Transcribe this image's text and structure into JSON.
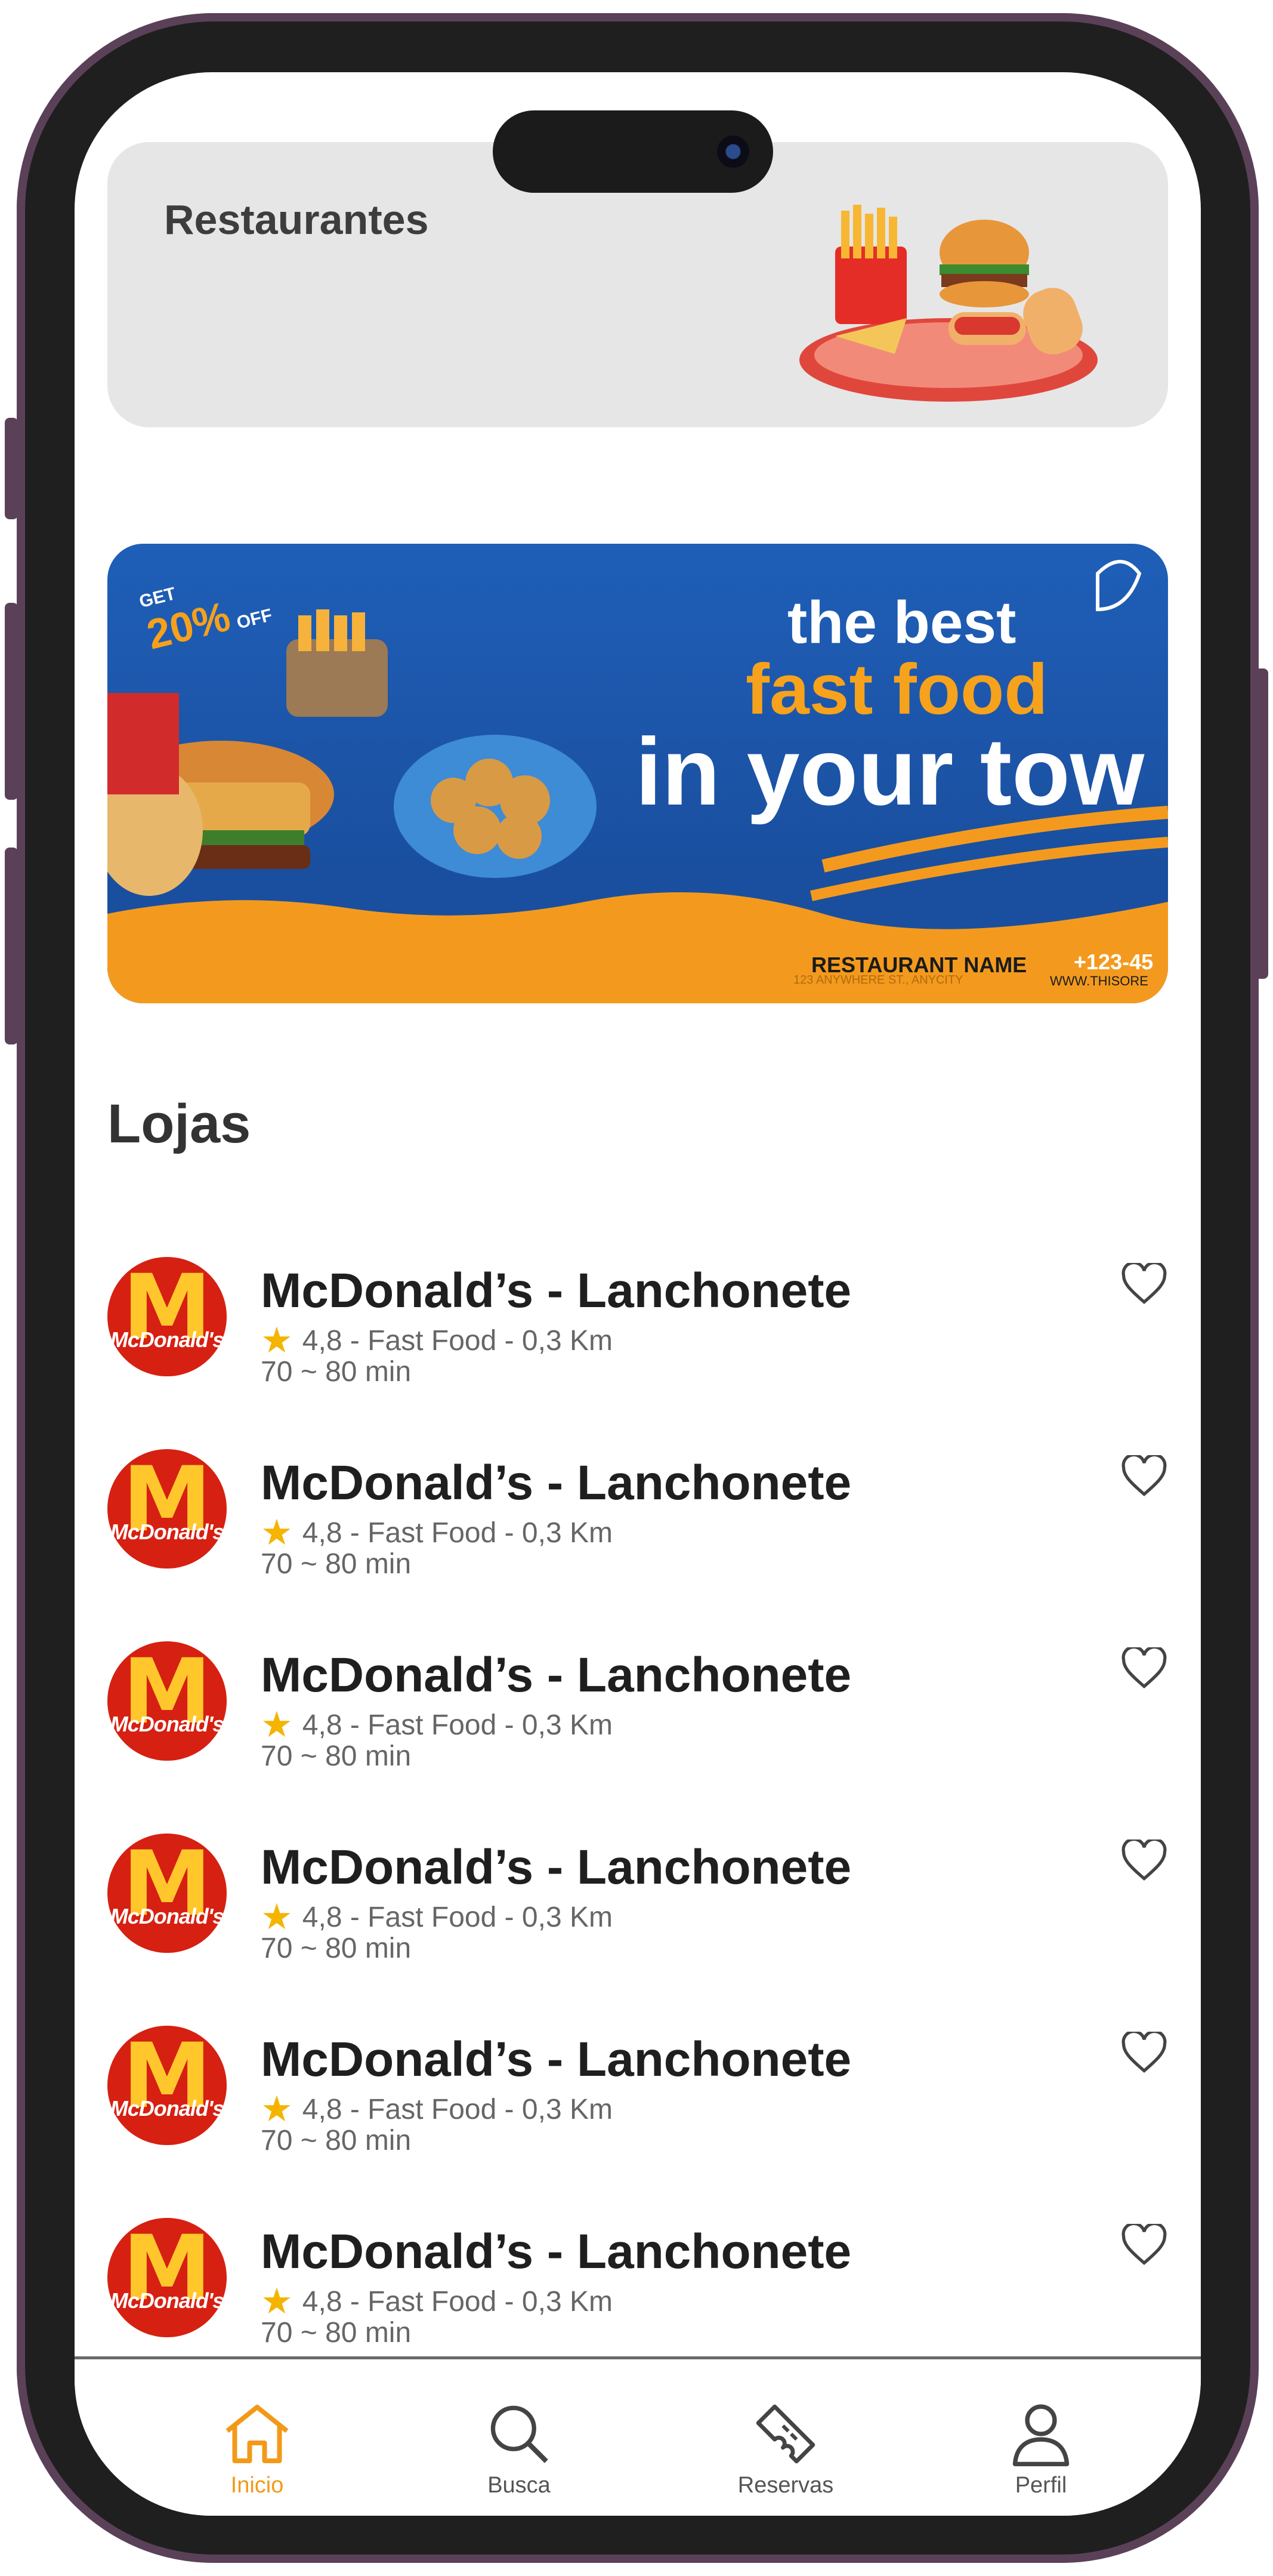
{
  "header": {
    "title": "Restaurantes"
  },
  "banner": {
    "promo_get": "GET",
    "promo_pct": "20%",
    "promo_off": "OFF",
    "line1": "the best",
    "line2": "fast food",
    "line3": "in your tow",
    "restaurant": "RESTAURANT NAME",
    "address": "123 ANYWHERE ST., ANYCITY",
    "phone": "+123-45",
    "web": "WWW.THISORE"
  },
  "stores_section": {
    "title": "Lojas"
  },
  "stores": [
    {
      "logo_text": "McDonald's",
      "name": "McDonald’s - Lanchonete",
      "meta": "4,8 - Fast Food - 0,3 Km",
      "time": "70 ~ 80 min"
    },
    {
      "logo_text": "McDonald's",
      "name": "McDonald’s - Lanchonete",
      "meta": "4,8 - Fast Food - 0,3 Km",
      "time": "70 ~ 80 min"
    },
    {
      "logo_text": "McDonald's",
      "name": "McDonald’s - Lanchonete",
      "meta": "4,8 - Fast Food - 0,3 Km",
      "time": "70 ~ 80 min"
    },
    {
      "logo_text": "McDonald's",
      "name": "McDonald’s - Lanchonete",
      "meta": "4,8 - Fast Food - 0,3 Km",
      "time": "70 ~ 80 min"
    },
    {
      "logo_text": "McDonald's",
      "name": "McDonald’s - Lanchonete",
      "meta": "4,8 - Fast Food - 0,3 Km",
      "time": "70 ~ 80 min"
    },
    {
      "logo_text": "McDonald's",
      "name": "McDonald’s - Lanchonete",
      "meta": "4,8 - Fast Food - 0,3 Km",
      "time": "70 ~ 80 min"
    }
  ],
  "nav": {
    "items": [
      {
        "label": "Inicio",
        "icon": "home-icon",
        "active": true
      },
      {
        "label": "Busca",
        "icon": "search-icon",
        "active": false
      },
      {
        "label": "Reservas",
        "icon": "ticket-icon",
        "active": false
      },
      {
        "label": "Perfil",
        "icon": "user-icon",
        "active": false
      }
    ]
  },
  "colors": {
    "accent": "#f29a18",
    "star": "#f4b400",
    "brand_red": "#d62012",
    "brand_yellow": "#ffc72c",
    "banner_blue": "#1f5fb8"
  }
}
